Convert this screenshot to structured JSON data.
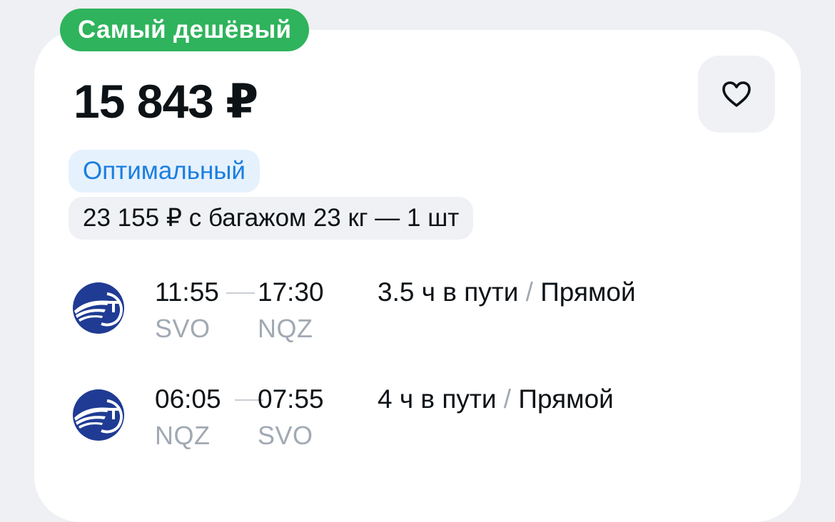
{
  "badge": "Самый дешёвый",
  "price": "15 843 ₽",
  "tariff": {
    "label": "Оптимальный",
    "baggage_offer": "23 155 ₽ с багажом 23 кг — 1 шт"
  },
  "favorite": {
    "icon": "heart-outline-icon"
  },
  "airline": {
    "logo": "aeroflot-logo"
  },
  "colors": {
    "badge_bg": "#2fb35c",
    "tariff_text": "#1a7ee0",
    "tariff_bg": "#e5f1fd",
    "logo_blue": "#1f3b93"
  },
  "segments": [
    {
      "depart_time": "11:55",
      "arrive_time": "17:30",
      "depart_code": "SVO",
      "arrive_code": "NQZ",
      "duration": "3.5 ч в пути",
      "separator": "/",
      "type": "Прямой"
    },
    {
      "depart_time": "06:05",
      "arrive_time": "07:55",
      "depart_code": "NQZ",
      "arrive_code": "SVO",
      "duration": "4 ч в пути",
      "separator": "/",
      "type": "Прямой"
    }
  ]
}
